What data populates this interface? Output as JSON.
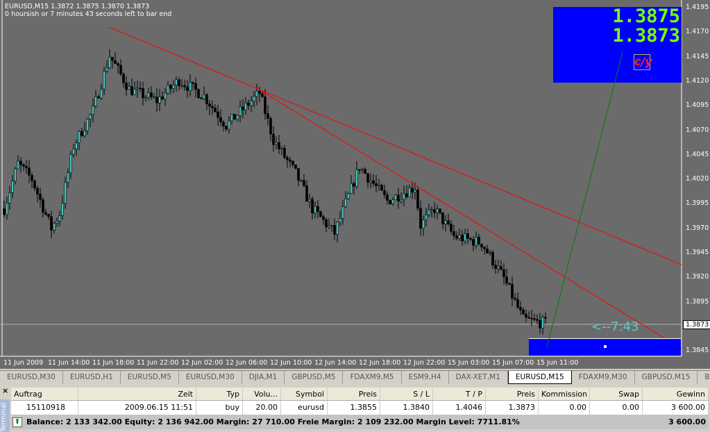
{
  "chart": {
    "symbol_line": "EURUSD,M15  1.3872 1.3875 1.3870 1.3873",
    "timer_line": "0 hoursish or 7 minutes 43 seconds left to bar end",
    "ask": "1.3875",
    "bid": "1.3873",
    "cy_label": "c/y",
    "countdown": "<--7:43",
    "current_price": "1.3873",
    "price_axis": [
      "1.4195",
      "1.4170",
      "1.4145",
      "1.4120",
      "1.4095",
      "1.4070",
      "1.4045",
      "1.4020",
      "1.3995",
      "1.3970",
      "1.3945",
      "1.3920",
      "1.3895",
      "1.3845"
    ],
    "time_axis": [
      "11 Jun 2009",
      "11 Jun 14:00",
      "11 Jun 18:00",
      "11 Jun 22:00",
      "12 Jun 02:00",
      "12 Jun 06:00",
      "12 Jun 10:00",
      "12 Jun 14:00",
      "12 Jun 18:00",
      "12 Jun 22:00",
      "15 Jun 03:00",
      "15 Jun 07:00",
      "15 Jun 11:00"
    ],
    "colors": {
      "bg": "#6b6b6b",
      "bull": "#40c8c0",
      "bear": "#000000",
      "trend": "#ff0000",
      "green": "#008000",
      "panel": "#0000ff"
    },
    "price_path": [
      [
        0,
        1.399
      ],
      [
        5,
        1.4036
      ],
      [
        10,
        1.402
      ],
      [
        17,
        1.397
      ],
      [
        20,
        1.3985
      ],
      [
        25,
        1.4054
      ],
      [
        32,
        1.409
      ],
      [
        38,
        1.4146
      ],
      [
        45,
        1.4112
      ],
      [
        55,
        1.41
      ],
      [
        63,
        1.4121
      ],
      [
        72,
        1.4105
      ],
      [
        80,
        1.4075
      ],
      [
        92,
        1.4108
      ],
      [
        97,
        1.406
      ],
      [
        105,
        1.4026
      ],
      [
        111,
        1.399
      ],
      [
        119,
        1.3965
      ],
      [
        128,
        1.4033
      ],
      [
        138,
        1.3998
      ],
      [
        148,
        1.4012
      ],
      [
        150,
        1.3973
      ],
      [
        155,
        1.399
      ],
      [
        162,
        1.3962
      ],
      [
        172,
        1.3955
      ],
      [
        180,
        1.3919
      ],
      [
        187,
        1.3877
      ],
      [
        195,
        1.3873
      ]
    ]
  },
  "tabs": [
    "EURUSD,M30",
    "EURUSD,H1",
    "EURUSD,M5",
    "EURUSD,M30",
    "DJIA,M1",
    "GBPUSD,M5",
    "FDAXM9,M5",
    "ESM9,H4",
    "DAX-XET,M1",
    "EURUSD,M15",
    "FDAXM9,M30",
    "GBPUSD,M15",
    "B"
  ],
  "terminal": {
    "side_label": "Terminal",
    "headers": [
      "Auftrag",
      "Zeit",
      "Typ",
      "Volu...",
      "Symbol",
      "Preis",
      "S / L",
      "T / P",
      "Preis",
      "Kommission",
      "Swap",
      "Gewinn"
    ],
    "row": [
      "15110918",
      "2009.06.15 11:51",
      "buy",
      "20.00",
      "eurusd",
      "1.3855",
      "1.3840",
      "1.4046",
      "1.3873",
      "0.00",
      "0.00",
      "3 600.00"
    ],
    "balance_text": "Balance: 2 133 342.00  Equity: 2 136 942.00  Margin: 27 710.00  Freie Margin: 2 109 232.00  Margin Level: 7711.81%",
    "total": "3 600.00"
  }
}
